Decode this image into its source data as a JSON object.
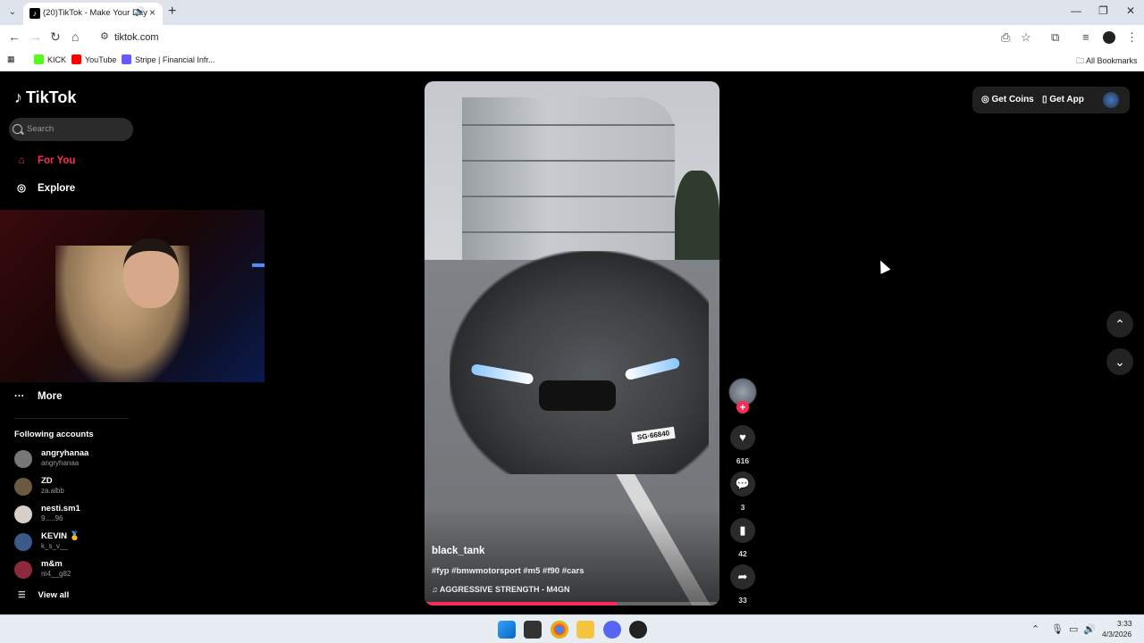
{
  "browser": {
    "tab_title": "(20)TikTok - Make Your Day",
    "url": "tiktok.com",
    "bookmarks": [
      {
        "label": "KICK",
        "color": "#53fc18"
      },
      {
        "label": "YouTube",
        "color": "#ff0000"
      },
      {
        "label": "Stripe | Financial Infr...",
        "color": "#635bff"
      }
    ],
    "all_bookmarks": "All Bookmarks"
  },
  "tiktok": {
    "logo": "TikTok",
    "search_placeholder": "Search",
    "nav": {
      "for_you": "For You",
      "explore": "Explore",
      "more": "More"
    },
    "following_title": "Following accounts",
    "following": [
      {
        "name": "angryhanaa",
        "handle": "angryhanaa"
      },
      {
        "name": "ZD",
        "handle": "za.albb"
      },
      {
        "name": "nesti.sm1",
        "handle": "9.....96"
      },
      {
        "name": "KEVIN 🥇",
        "handle": "k_s_v__"
      },
      {
        "name": "m&m",
        "handle": "m4__g82"
      }
    ],
    "view_all": "View all",
    "top_actions": {
      "get_coins": "Get Coins",
      "get_app": "Get App"
    },
    "video": {
      "author": "black_tank",
      "caption": "#fyp #bmwmotorsport #m5 #f90 #cars",
      "music": "AGGRESSIVE STRENGTH - M4GN",
      "plate": "SG·66840",
      "progress": 0.65
    },
    "actions": {
      "likes": "616",
      "comments": "3",
      "saves": "42",
      "shares": "33"
    }
  },
  "taskbar": {
    "time": "3:33",
    "date": "4/3/2026"
  },
  "colors": {
    "accent": "#fe2c55"
  }
}
